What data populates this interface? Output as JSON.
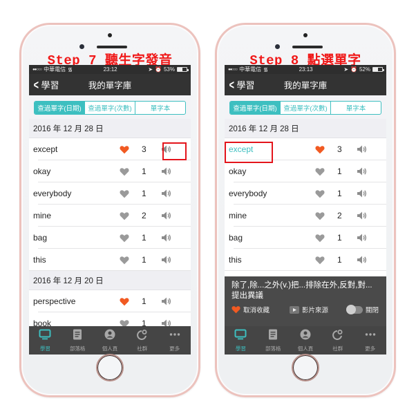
{
  "colors": {
    "accent": "#3dbfc0",
    "heart_on": "#f15a22",
    "heart_off": "#9a9a9a",
    "highlight": "#e3141b",
    "step_title": "#f01818"
  },
  "panels": [
    {
      "step_title": "Step 7 聽生字發音",
      "status": {
        "carrier": "中華電信",
        "signal": "●●○○○",
        "time": "23:12",
        "battery": "53%",
        "battery_fraction": 0.53
      },
      "nav": {
        "back_label": "學習",
        "title": "我的單字庫"
      },
      "segments": [
        {
          "label": "查過單字(日期)",
          "active": true
        },
        {
          "label": "查過單字(次數)",
          "active": false
        },
        {
          "label": "單字本",
          "active": false
        }
      ],
      "sections": [
        {
          "date": "2016 年 12 月 28 日",
          "words": [
            {
              "word": "except",
              "favorite": true,
              "count": "3"
            },
            {
              "word": "okay",
              "favorite": false,
              "count": "1"
            },
            {
              "word": "everybody",
              "favorite": false,
              "count": "1"
            },
            {
              "word": "mine",
              "favorite": false,
              "count": "2"
            },
            {
              "word": "bag",
              "favorite": false,
              "count": "1"
            },
            {
              "word": "this",
              "favorite": false,
              "count": "1"
            }
          ]
        },
        {
          "date": "2016 年 12 月 20 日",
          "words": [
            {
              "word": "perspective",
              "favorite": true,
              "count": "1"
            },
            {
              "word": "book",
              "favorite": false,
              "count": "1"
            }
          ]
        }
      ],
      "highlight": "speaker-except"
    },
    {
      "step_title": "Step 8 點選單字",
      "status": {
        "carrier": "中華電信",
        "signal": "●●○○○",
        "time": "23:13",
        "battery": "52%",
        "battery_fraction": 0.52
      },
      "nav": {
        "back_label": "學習",
        "title": "我的單字庫"
      },
      "segments": [
        {
          "label": "查過單字(日期)",
          "active": true
        },
        {
          "label": "查過單字(次數)",
          "active": false
        },
        {
          "label": "單字本",
          "active": false
        }
      ],
      "sections": [
        {
          "date": "2016 年 12 月 28 日",
          "words": [
            {
              "word": "except",
              "favorite": true,
              "count": "3",
              "selected": true
            },
            {
              "word": "okay",
              "favorite": false,
              "count": "1"
            },
            {
              "word": "everybody",
              "favorite": false,
              "count": "1"
            },
            {
              "word": "mine",
              "favorite": false,
              "count": "2"
            },
            {
              "word": "bag",
              "favorite": false,
              "count": "1"
            },
            {
              "word": "this",
              "favorite": false,
              "count": "1"
            }
          ]
        }
      ],
      "highlight": "word-except",
      "popup": {
        "definition": "除了,除...之外(v.)把...排除在外,反對,對...提出異議",
        "unfavorite_label": "取消收藏",
        "video_source_label": "影片來源",
        "close_label": "關閉"
      }
    }
  ],
  "tabbar": [
    {
      "label": "學習",
      "icon": "monitor-icon",
      "active": true
    },
    {
      "label": "部落格",
      "icon": "document-icon",
      "active": false
    },
    {
      "label": "個人頁",
      "icon": "person-icon",
      "active": false
    },
    {
      "label": "社群",
      "icon": "community-icon",
      "active": false
    },
    {
      "label": "更多",
      "icon": "more-icon",
      "active": false
    }
  ]
}
